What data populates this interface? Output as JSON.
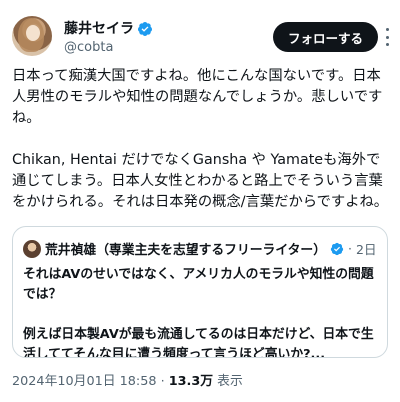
{
  "author": {
    "display_name": "藤井セイラ",
    "handle": "@cobta"
  },
  "follow_label": "フォローする",
  "tweet_text": "日本って痴漢大国ですよね。他にこんな国ないです。日本人男性のモラルや知性の問題なんでしょうか。悲しいですね。\n\nChikan, Hentai だけでなくGansha や Yamateも海外で通じてしまう。日本人女性とわかると路上でそういう言葉をかけられる。それは日本発の概念/言葉だからですよね。",
  "quote": {
    "display_name": "荒井禎雄（専業主夫を志望するフリーライター）",
    "separator": "·",
    "time": "2日",
    "text": "それはAVのせいではなく、アメリカ人のモラルや知性の問題では？\n\n例えば日本製AVが最も流通してるのは日本だけど、日本で生活しててそんな目に遭う頻度って言うほど高いか?..."
  },
  "meta": {
    "timestamp": "2024年10月01日 18:58",
    "separator": "·",
    "views_count": "13.3万",
    "views_label": "表示"
  },
  "colors": {
    "verified_blue": "#1d9bf0",
    "text": "#0f1419",
    "secondary": "#536471",
    "border": "#cfd9de"
  }
}
